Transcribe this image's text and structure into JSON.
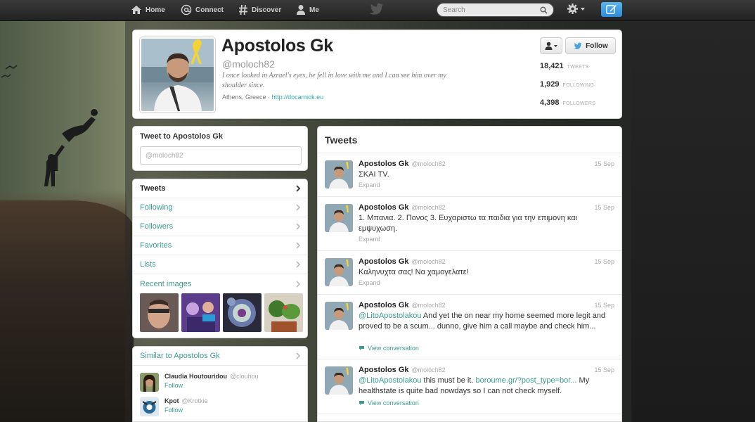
{
  "topbar": {
    "nav": [
      {
        "label": "Home",
        "icon": "home-icon"
      },
      {
        "label": "Connect",
        "icon": "at-icon"
      },
      {
        "label": "Discover",
        "icon": "hash-icon"
      },
      {
        "label": "Me",
        "icon": "person-icon"
      }
    ],
    "search_placeholder": "Search"
  },
  "profile": {
    "name": "Apostolos Gk",
    "handle": "@moloch82",
    "bio": "I once looked in Azrael's eyes, he fell in love with me and I can see him over my shoulder since.",
    "location": "Athens, Greece",
    "url": "http://docamiok.eu",
    "follow_label": "Follow",
    "stats": [
      {
        "value": "18,421",
        "label": "TWEETS"
      },
      {
        "value": "1,929",
        "label": "FOLLOWING"
      },
      {
        "value": "4,398",
        "label": "FOLLOWERS"
      }
    ]
  },
  "tweetbox": {
    "title": "Tweet to Apostolos Gk",
    "placeholder": "@moloch82"
  },
  "sidenav": {
    "items": [
      {
        "label": "Tweets"
      },
      {
        "label": "Following"
      },
      {
        "label": "Followers"
      },
      {
        "label": "Favorites"
      },
      {
        "label": "Lists"
      },
      {
        "label": "Recent images"
      }
    ]
  },
  "similar": {
    "title": "Similar to Apostolos Gk",
    "users": [
      {
        "name": "Claudia Houtouridou",
        "handle": "@clouhou",
        "follow": "Follow"
      },
      {
        "name": "Kpot",
        "handle": "@Krotkie",
        "follow": "Follow"
      }
    ]
  },
  "stream": {
    "title": "Tweets",
    "tweets": [
      {
        "name": "Apostolos Gk",
        "handle": "@moloch82",
        "time": "15 Sep",
        "mention": "",
        "text": "ΣΚΑΙ TV.",
        "action": "Expand"
      },
      {
        "name": "Apostolos Gk",
        "handle": "@moloch82",
        "time": "15 Sep",
        "mention": "",
        "text": "1. Μπανια. 2. Πονος 3. Ευχαριστω τα παιδια για την επιμονη και εμψυχωση.",
        "action": "Expand"
      },
      {
        "name": "Apostolos Gk",
        "handle": "@moloch82",
        "time": "15 Sep",
        "mention": "",
        "text": "Καληνυχτα σας! Να χαμογελατε!",
        "action": "Expand"
      },
      {
        "name": "Apostolos Gk",
        "handle": "@moloch82",
        "time": "15 Sep",
        "mention": "@LitoApostolakou",
        "text": " And yet the on near my home seemed more legit and proved to be a scum... dunno, give him a call maybe and check him...",
        "action": "View conversation"
      },
      {
        "name": "Apostolos Gk",
        "handle": "@moloch82",
        "time": "15 Sep",
        "mention": "@LitoApostolakou",
        "text": " this must be it. ",
        "link": "boroume.gr/?post_type=bor...",
        "text2": " My healthstate is quite bad nowdays so I can not check myself.",
        "action": "View conversation"
      }
    ]
  },
  "colors": {
    "accent_teal": "#3c9c92",
    "compose_blue": "#2d8bd8",
    "topbar": "#2a2a2a"
  }
}
